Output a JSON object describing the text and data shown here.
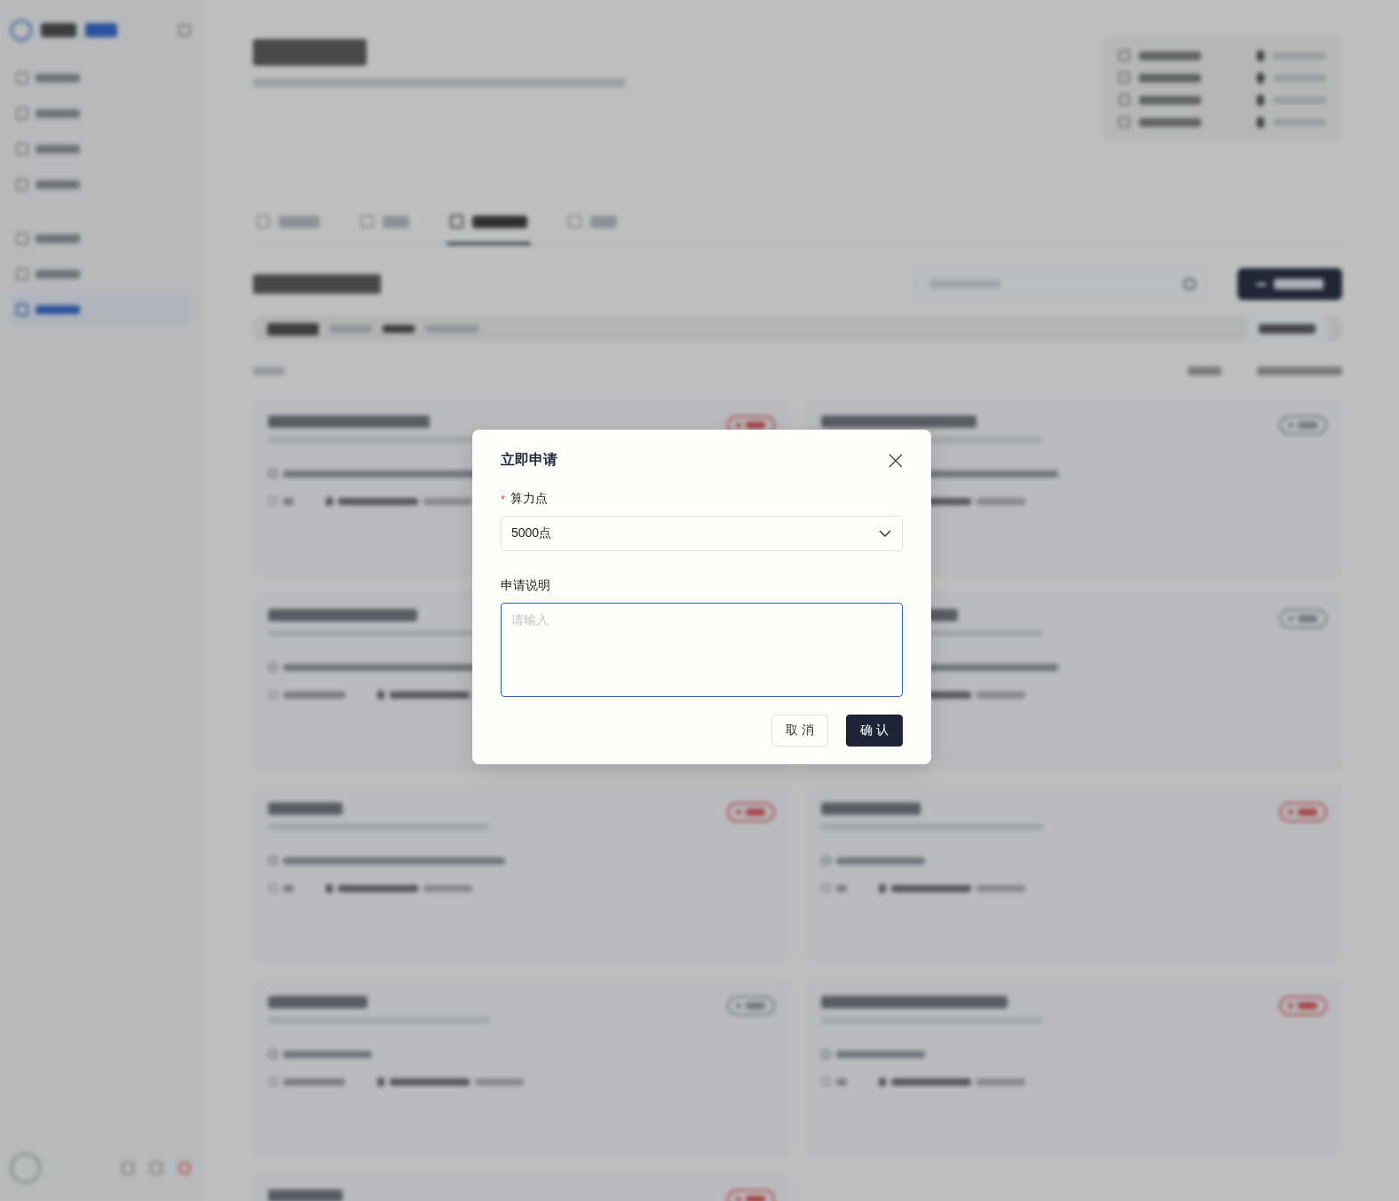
{
  "dialog": {
    "title": "立即申请",
    "fields": [
      {
        "kind": "select",
        "label": "算力点",
        "required_mark": "*",
        "value": "5000点"
      },
      {
        "kind": "textarea",
        "label": "申请说明",
        "placeholder": "请输入",
        "focused": true
      }
    ],
    "buttons": [
      {
        "label": "取 消",
        "primary": false
      },
      {
        "label": "确 认",
        "primary": true
      }
    ]
  }
}
